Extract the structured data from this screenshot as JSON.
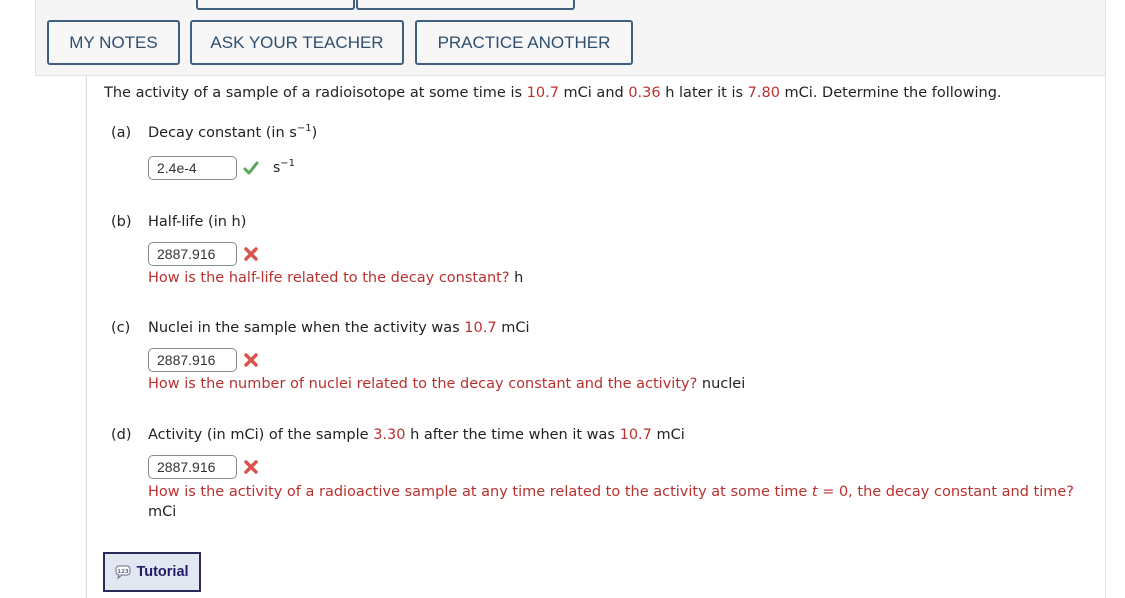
{
  "toolbar": {
    "my_notes": "MY NOTES",
    "ask_teacher": "ASK YOUR TEACHER",
    "practice_another": "PRACTICE ANOTHER"
  },
  "problem": {
    "t1": "The activity of a sample of a radioisotope at some time is ",
    "v1": "10.7",
    "t2": " mCi and ",
    "v2": "0.36",
    "t3": " h later it is ",
    "v3": "7.80",
    "t4": " mCi. Determine the following."
  },
  "parts": {
    "a": {
      "letter": "(a)",
      "label": "Decay constant (in s",
      "label_sup": "−1",
      "label_end": ")",
      "value": "2.4e-4",
      "status": "correct",
      "unit": "s",
      "unit_sup": "−1"
    },
    "b": {
      "letter": "(b)",
      "label": "Half-life (in h)",
      "value": "2887.916",
      "status": "incorrect",
      "hint": "How is the half-life related to the decay constant?",
      "unit": " h"
    },
    "c": {
      "letter": "(c)",
      "label": "Nuclei in the sample when the activity was ",
      "label_value": "10.7",
      "label_end": " mCi",
      "value": "2887.916",
      "status": "incorrect",
      "hint": "How is the number of nuclei related to the decay constant and the activity?",
      "unit": " nuclei"
    },
    "d": {
      "letter": "(d)",
      "label": "Activity (in mCi) of the sample ",
      "label_value1": "3.30",
      "label_mid": " h after the time when it was ",
      "label_value2": "10.7",
      "label_end": " mCi",
      "value": "2887.916",
      "status": "incorrect",
      "hint_pre": "How is the activity of a radioactive sample at any time related to the activity at some time ",
      "hint_var": "t",
      "hint_post": " = 0, the decay constant and time?",
      "unit": " mCi"
    }
  },
  "tutorial": {
    "label": "Tutorial",
    "icon": "123-speech-bubble-icon"
  },
  "colors": {
    "accent_red": "#b8312f",
    "button_border": "#3f5f7f",
    "correct_green": "#5aa55a",
    "incorrect_red": "#d9534f"
  }
}
